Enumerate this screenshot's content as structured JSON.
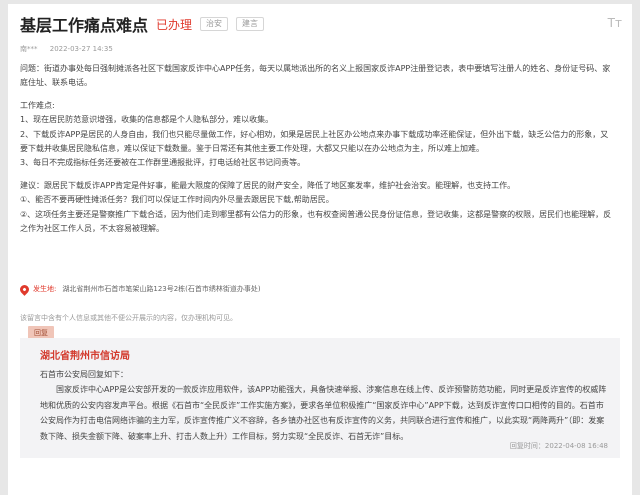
{
  "header": {
    "title": "基层工作痛点难点",
    "status": "已办理",
    "tags": [
      "治安",
      "建言"
    ],
    "font_size_toggle": "Tт"
  },
  "meta": {
    "author": "南***",
    "datetime": "2022-03-27 14:35"
  },
  "body": {
    "question": "问题：街道办事处每日强制摊派各社区下载国家反诈中心APP任务，每天以属地派出所的名义上报国家反诈APP注册登记表，表中要填写注册人的姓名、身份证号码、家庭住址、联系电话。",
    "difficulty_heading": "工作难点:",
    "difficulties": [
      "1、现在居民防范意识增强，收集的信息都是个人隐私部分，难以收集。",
      "2、下载反诈APP是居民的人身自由，我们也只能尽量做工作，好心相劝，如果是居民上社区办公地点来办事下载成功率还能保证，但外出下载，缺乏公信力的形象，又要下载并收集居民隐私信息，难以保证下载数量。鉴于日常还有其他主要工作处理，大都又只能以在办公地点为主，所以难上加难。",
      "3、每日不完成指标任务还要被在工作群里通报批评，打电话给社区书记问责等。"
    ],
    "suggestion": "建议：跟居民下载反诈APP肯定是件好事，能最大限度的保障了居民的财产安全，降低了地区案发率，维护社会治安。能理解，也支持工作。",
    "points": [
      "①、能否不要再硬性摊派任务？我们可以保证工作时间内外尽量去跟居民下载,帮助居民。",
      "②、这项任务主要还是警察推广下载合适，因为他们走到哪里都有公信力的形象，也有权查阅普通公民身份证信息，登记收集，这都是警察的权限，居民们也能理解，反之作为社区工作人员，不太容易被理解。"
    ]
  },
  "location": {
    "label": "发生地:",
    "address": "湖北省荆州市石首市笔架山路123号2栋(石首市绣林街道办事处)"
  },
  "disclaimer": "该留言中含有个人信息或其他不便公开展示的内容，仅办理机构可见。",
  "reply": {
    "badge": "回复",
    "org": "湖北省荆州市信访局",
    "paragraphs": [
      "石首市公安局回复如下：",
      "国家反诈中心APP是公安部开发的一款反诈应用软件，该APP功能强大，具备快速举报、涉案信息在线上传、反诈预警防范功能，同时更是反诈宣传的权威阵地和优质的公安内容发声平台。根据《石首市“全民反诈”工作实施方案》，要求各单位积极推广“国家反诈中心”APP下载，达到反诈宣传口口相传的目的。石首市公安局作为打击电信网络诈骗的主力军，反诈宣传推广义不容辞，各乡镇办社区也有反诈宣传的义务，共同联合进行宣传和推广，以此实现“两降两升”（即：发案数下降、损失金额下降、破案率上升、打击人数上升）工作目标，努力实现“全民反诈、石首无诈”目标。"
    ],
    "time": "回复时间：2022-04-08 16:48"
  }
}
